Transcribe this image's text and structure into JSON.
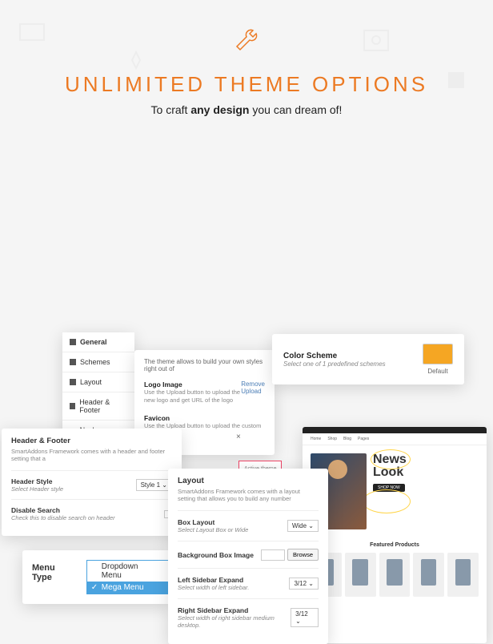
{
  "hero": {
    "title": "UNLIMITED THEME OPTIONS",
    "subtitle_pre": "To craft ",
    "subtitle_bold": "any design",
    "subtitle_post": " you can dream of!"
  },
  "sidebar": {
    "items": [
      {
        "label": "General",
        "icon": "gear-icon"
      },
      {
        "label": "Schemes",
        "icon": "grid-icon"
      },
      {
        "label": "Layout",
        "icon": "layout-icon"
      },
      {
        "label": "Header & Footer",
        "icon": "bars-icon"
      },
      {
        "label": "Navbar Options",
        "icon": "menu-icon"
      }
    ]
  },
  "main": {
    "intro": "The theme allows to build your own styles right out of",
    "logo": {
      "title": "Logo Image",
      "desc": "Use the Upload button to upload the new logo and get URL of the logo",
      "remove": "Remove Upload"
    },
    "favicon": {
      "title": "Favicon",
      "desc": "Use the Upload button to upload the custom favicon"
    }
  },
  "color_scheme": {
    "title": "Color Scheme",
    "desc": "Select one of 1 predefined schemes",
    "swatch": "Default",
    "color": "#f5a623"
  },
  "header_footer": {
    "title": "Header & Footer",
    "desc": "SmartAddons Framework comes with a header and footer setting that a",
    "style_label": "Header Style",
    "style_desc": "Select Header style",
    "style_value": "Style 1",
    "disable_label": "Disable Search",
    "disable_desc": "Check this to disable search on header"
  },
  "layout": {
    "title": "Layout",
    "desc": "SmartAddons Framework comes with a layout setting that allows you to build any number",
    "box_label": "Box Layout",
    "box_desc": "Select Layout Box or Wide",
    "box_value": "Wide",
    "bg_label": "Background Box Image",
    "browse": "Browse",
    "left_label": "Left Sidebar Expand",
    "left_desc": "Select width of left sidebar.",
    "left_value": "3/12",
    "right_label": "Right Sidebar Expand",
    "right_desc": "Select width of right sidebar medium desktop.",
    "right_value": "3/12"
  },
  "menu_type": {
    "label": "Menu Type",
    "options": [
      "Dropdown Menu",
      "Mega Menu"
    ],
    "selected": "Mega Menu"
  },
  "preview": {
    "nav": [
      "Home",
      "Shop",
      "Blog",
      "Pages"
    ],
    "news_title1": "News",
    "news_title2": "Look",
    "shop_btn": "SHOP NOW",
    "section": "Featured Products"
  },
  "active_theme": "Active theme"
}
